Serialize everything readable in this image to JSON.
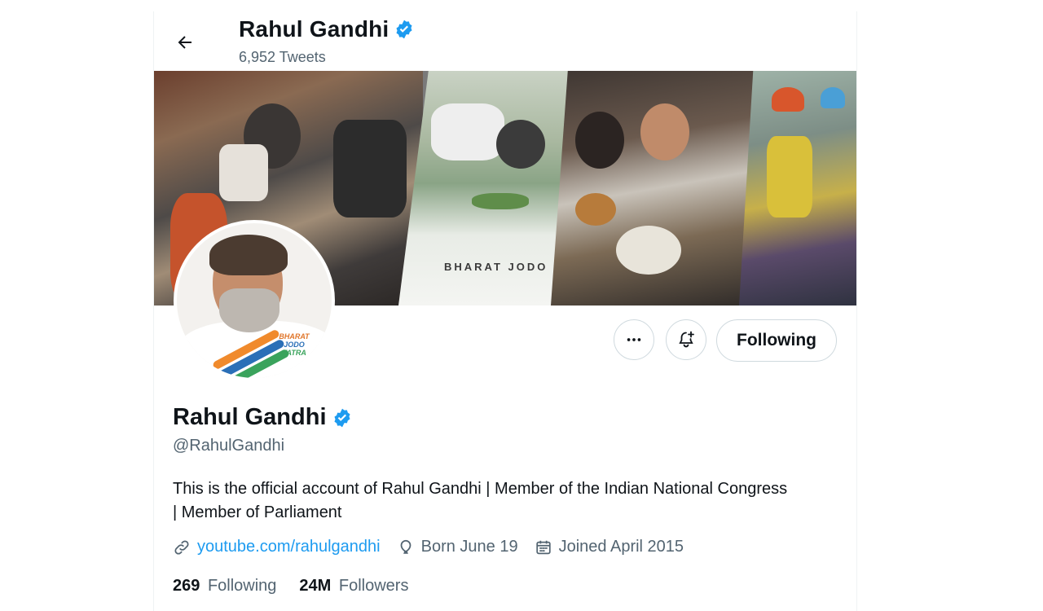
{
  "header": {
    "name": "Rahul Gandhi",
    "tweet_count": "6,952 Tweets",
    "back_icon": "arrow-left-icon",
    "verified_icon": "verified-badge-icon"
  },
  "banner": {
    "caption": "BHARAT JODO"
  },
  "avatar": {
    "logo_lines": [
      "BHARAT",
      "JODO",
      "YATRA"
    ]
  },
  "actions": {
    "more_icon": "more-horizontal-icon",
    "notify_icon": "bell-plus-icon",
    "following_label": "Following"
  },
  "profile": {
    "name": "Rahul Gandhi",
    "handle": "@RahulGandhi",
    "bio": "This is the official account of Rahul Gandhi | Member of the Indian National Congress | Member of Parliament",
    "website": "youtube.com/rahulgandhi",
    "birthday": "Born June 19",
    "joined": "Joined April 2015"
  },
  "stats": {
    "following_count": "269",
    "following_label": "Following",
    "followers_count": "24M",
    "followers_label": "Followers"
  },
  "colors": {
    "verified": "#1d9bf0",
    "link": "#1d9bf0",
    "secondary_text": "#536471",
    "primary_text": "#0f1419",
    "border": "#cfd9de"
  }
}
